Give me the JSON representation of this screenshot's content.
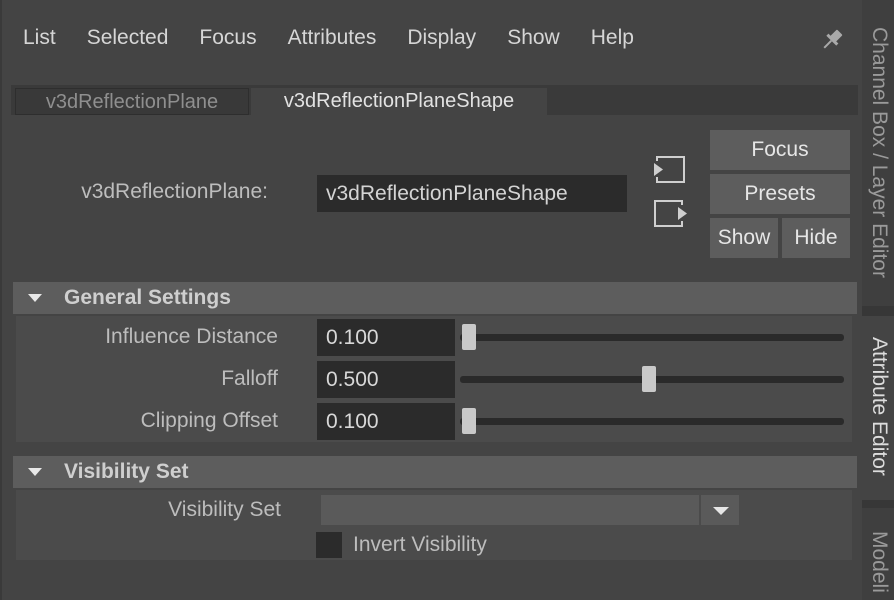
{
  "menu": [
    "List",
    "Selected",
    "Focus",
    "Attributes",
    "Display",
    "Show",
    "Help"
  ],
  "tabs": [
    {
      "label": "v3dReflectionPlane",
      "active": false
    },
    {
      "label": "v3dReflectionPlaneShape",
      "active": true
    }
  ],
  "node": {
    "label": "v3dReflectionPlane:",
    "value": "v3dReflectionPlaneShape"
  },
  "buttons": {
    "focus": "Focus",
    "presets": "Presets",
    "show": "Show",
    "hide": "Hide"
  },
  "general_settings": {
    "title": "General Settings",
    "attrs": [
      {
        "label": "Influence Distance",
        "value": "0.100",
        "slider_fraction": 0.0
      },
      {
        "label": "Falloff",
        "value": "0.500",
        "slider_fraction": 0.5
      },
      {
        "label": "Clipping Offset",
        "value": "0.100",
        "slider_fraction": 0.0
      }
    ]
  },
  "visibility_set": {
    "title": "Visibility Set",
    "combo_label": "Visibility Set",
    "combo_value": "",
    "invert_label": "Invert Visibility",
    "invert_checked": false
  },
  "side_tabs": [
    {
      "label": "Channel Box / Layer Editor",
      "active": false
    },
    {
      "label": "Attribute Editor",
      "active": true
    },
    {
      "label": "Modeli",
      "active": false
    }
  ],
  "colors": {
    "panel_bg": "#444444",
    "field_bg": "#2b2b2b",
    "header_bg": "#5d5d5d"
  }
}
